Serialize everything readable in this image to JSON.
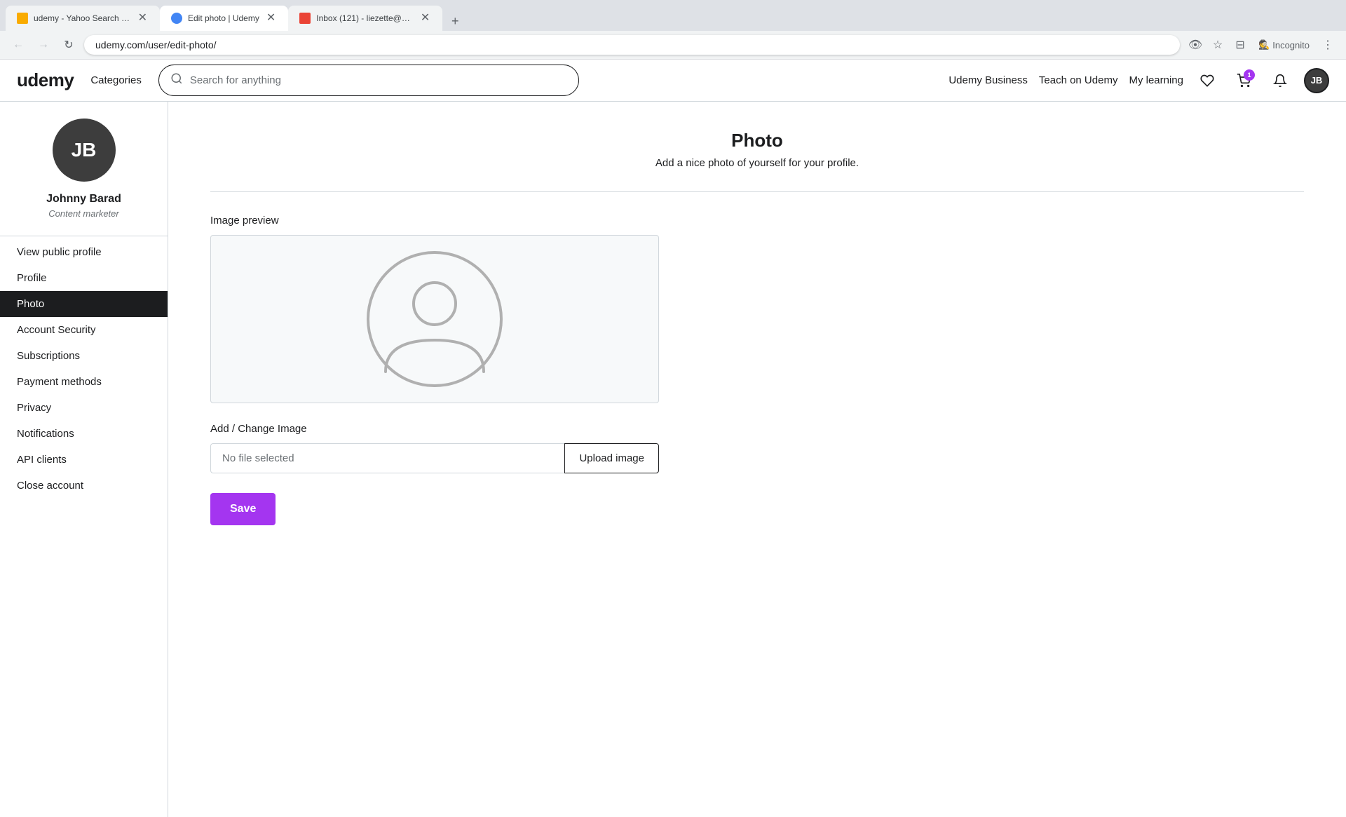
{
  "browser": {
    "tabs": [
      {
        "id": "tab1",
        "label": "udemy - Yahoo Search Results",
        "favicon_type": "yellow",
        "active": false
      },
      {
        "id": "tab2",
        "label": "Edit photo | Udemy",
        "favicon_type": "blue",
        "active": true
      },
      {
        "id": "tab3",
        "label": "Inbox (121) - liezette@pagefl...",
        "favicon_type": "red",
        "active": false
      }
    ],
    "new_tab_label": "+",
    "address": "udemy.com/user/edit-photo/",
    "incognito_label": "Incognito"
  },
  "header": {
    "logo_text": "udemy",
    "categories_label": "Categories",
    "search_placeholder": "Search for anything",
    "nav_links": [
      {
        "id": "udemy-business",
        "label": "Udemy Business"
      },
      {
        "id": "teach-on-udemy",
        "label": "Teach on Udemy"
      },
      {
        "id": "my-learning",
        "label": "My learning"
      }
    ],
    "cart_badge": "1",
    "user_initials": "JB"
  },
  "sidebar": {
    "user_name": "Johnny Barad",
    "user_title": "Content marketer",
    "user_initials": "JB",
    "nav_items": [
      {
        "id": "view-public-profile",
        "label": "View public profile",
        "active": false
      },
      {
        "id": "profile",
        "label": "Profile",
        "active": false
      },
      {
        "id": "photo",
        "label": "Photo",
        "active": true
      },
      {
        "id": "account-security",
        "label": "Account Security",
        "active": false
      },
      {
        "id": "subscriptions",
        "label": "Subscriptions",
        "active": false
      },
      {
        "id": "payment-methods",
        "label": "Payment methods",
        "active": false
      },
      {
        "id": "privacy",
        "label": "Privacy",
        "active": false
      },
      {
        "id": "notifications",
        "label": "Notifications",
        "active": false
      },
      {
        "id": "api-clients",
        "label": "API clients",
        "active": false
      },
      {
        "id": "close-account",
        "label": "Close account",
        "active": false
      }
    ]
  },
  "main": {
    "title": "Photo",
    "subtitle": "Add a nice photo of yourself for your profile.",
    "image_preview_label": "Image preview",
    "add_change_label": "Add / Change Image",
    "file_placeholder": "No file selected",
    "upload_button_label": "Upload image",
    "save_button_label": "Save"
  }
}
